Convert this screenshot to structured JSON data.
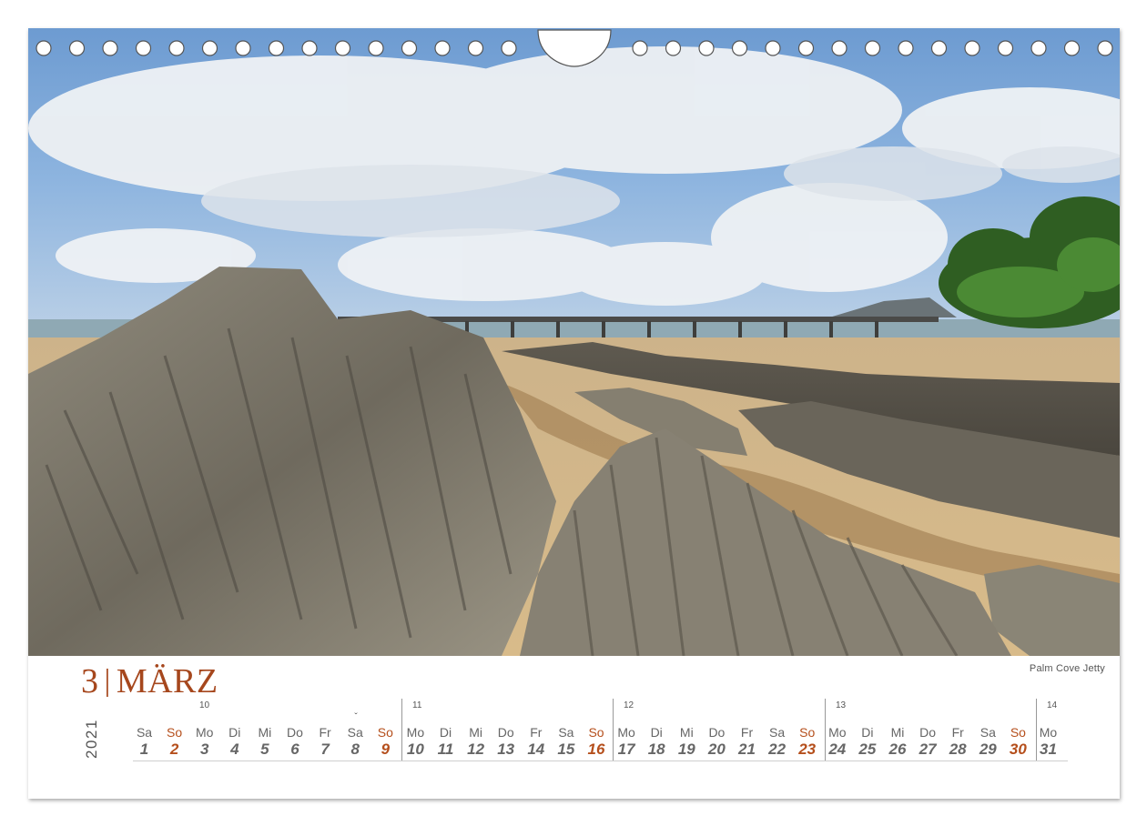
{
  "calendar": {
    "month_number": "3",
    "separator": "|",
    "month_name": "MÄRZ",
    "year": "2021",
    "caption": "Palm Cove Jetty",
    "colors": {
      "accent": "#a6471d",
      "sunday": "#b54f1c",
      "text": "#666666"
    },
    "weeks": [
      {
        "number": "10"
      },
      {
        "number": "11"
      },
      {
        "number": "12"
      },
      {
        "number": "13"
      },
      {
        "number": "14"
      }
    ],
    "days": [
      {
        "name": "Sa",
        "num": "1",
        "sunday": false
      },
      {
        "name": "So",
        "num": "2",
        "sunday": true
      },
      {
        "name": "Mo",
        "num": "3",
        "sunday": false
      },
      {
        "name": "Di",
        "num": "4",
        "sunday": false
      },
      {
        "name": "Mi",
        "num": "5",
        "sunday": false
      },
      {
        "name": "Do",
        "num": "6",
        "sunday": false
      },
      {
        "name": "Fr",
        "num": "7",
        "sunday": false
      },
      {
        "name": "Sa",
        "num": "8",
        "sunday": false
      },
      {
        "name": "So",
        "num": "9",
        "sunday": true
      },
      {
        "name": "Mo",
        "num": "10",
        "sunday": false
      },
      {
        "name": "Di",
        "num": "11",
        "sunday": false
      },
      {
        "name": "Mi",
        "num": "12",
        "sunday": false
      },
      {
        "name": "Do",
        "num": "13",
        "sunday": false
      },
      {
        "name": "Fr",
        "num": "14",
        "sunday": false
      },
      {
        "name": "Sa",
        "num": "15",
        "sunday": false
      },
      {
        "name": "So",
        "num": "16",
        "sunday": true
      },
      {
        "name": "Mo",
        "num": "17",
        "sunday": false
      },
      {
        "name": "Di",
        "num": "18",
        "sunday": false
      },
      {
        "name": "Mi",
        "num": "19",
        "sunday": false
      },
      {
        "name": "Do",
        "num": "20",
        "sunday": false
      },
      {
        "name": "Fr",
        "num": "21",
        "sunday": false
      },
      {
        "name": "Sa",
        "num": "22",
        "sunday": false
      },
      {
        "name": "So",
        "num": "23",
        "sunday": true
      },
      {
        "name": "Mo",
        "num": "24",
        "sunday": false
      },
      {
        "name": "Di",
        "num": "25",
        "sunday": false
      },
      {
        "name": "Mi",
        "num": "26",
        "sunday": false
      },
      {
        "name": "Do",
        "num": "27",
        "sunday": false
      },
      {
        "name": "Fr",
        "num": "28",
        "sunday": false
      },
      {
        "name": "Sa",
        "num": "29",
        "sunday": false
      },
      {
        "name": "So",
        "num": "30",
        "sunday": true
      },
      {
        "name": "Mo",
        "num": "31",
        "sunday": false
      }
    ],
    "marker": {
      "symbol": "ˇ"
    }
  },
  "photo": {
    "icon": "beach-rocks-landscape-photo"
  }
}
